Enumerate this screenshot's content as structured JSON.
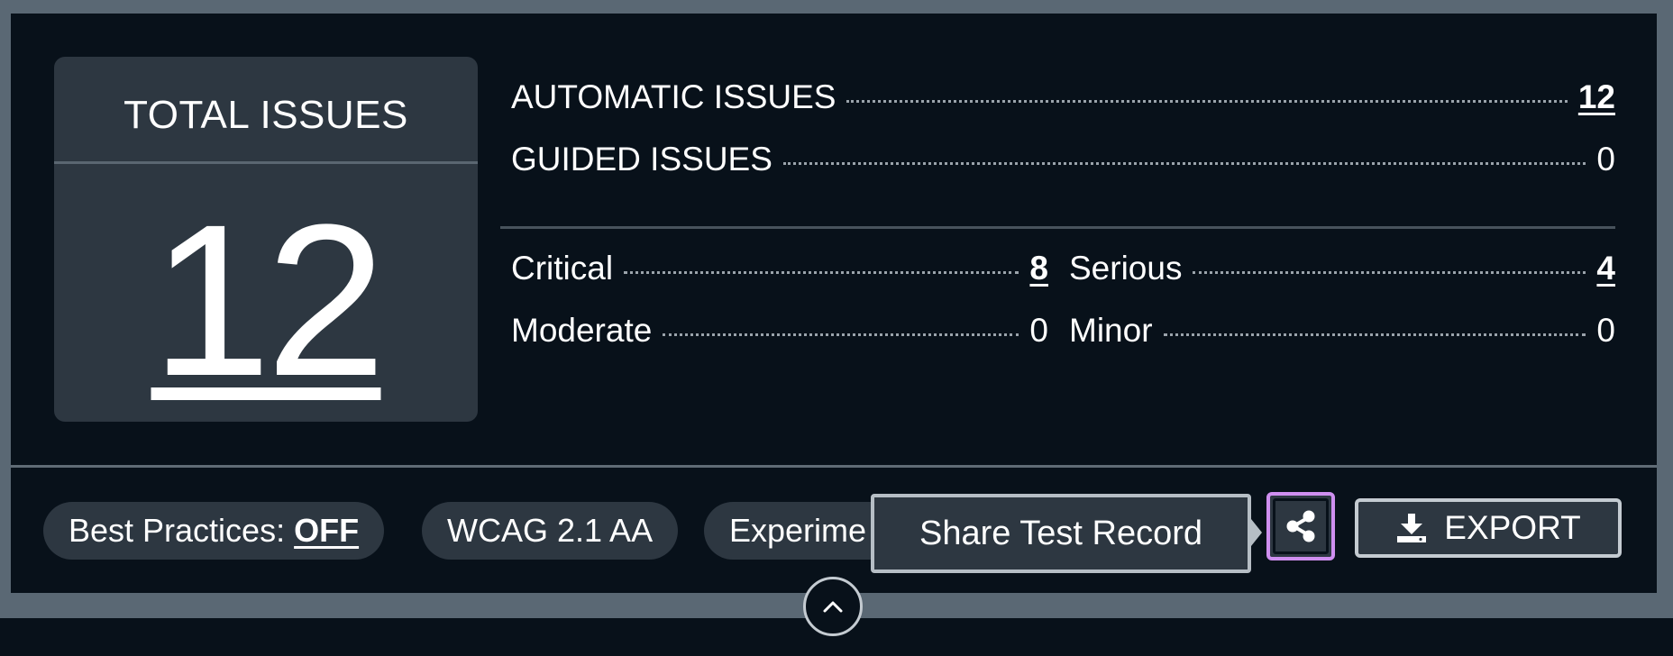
{
  "summary": {
    "total_title": "TOTAL ISSUES",
    "total_count": "12",
    "automatic_label": "AUTOMATIC ISSUES",
    "automatic_value": "12",
    "guided_label": "GUIDED ISSUES",
    "guided_value": "0"
  },
  "severity": {
    "critical_label": "Critical",
    "critical_value": "8",
    "serious_label": "Serious",
    "serious_value": "4",
    "moderate_label": "Moderate",
    "moderate_value": "0",
    "minor_label": "Minor",
    "minor_value": "0"
  },
  "footer": {
    "best_practices_label": "Best Practices:",
    "best_practices_value": "OFF",
    "wcag_label": "WCAG 2.1 AA",
    "experimental_label": "Experime",
    "share_tooltip": "Share Test Record",
    "export_label": "EXPORT"
  },
  "icons": {
    "share": "share-icon",
    "export": "download-icon",
    "collapse": "chevron-up-icon"
  },
  "colors": {
    "panel_bg": "#08111a",
    "card_bg": "#2d3741",
    "focus_ring": "#cf8ff0"
  }
}
